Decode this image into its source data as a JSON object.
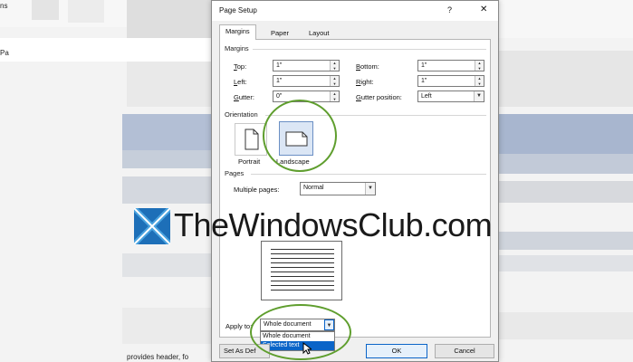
{
  "background": {
    "top_left_text": "ns",
    "side_label": "Pa",
    "bottom_text": "provides header, fo"
  },
  "dialog": {
    "title": "Page Setup",
    "help_glyph": "?",
    "close_glyph": "✕",
    "tabs": [
      {
        "label": "Margins",
        "active": true
      },
      {
        "label": "Paper",
        "active": false
      },
      {
        "label": "Layout",
        "active": false
      }
    ],
    "margins": {
      "section_label": "Margins",
      "top": {
        "label_u": "T",
        "label_rest": "op:",
        "value": "1\""
      },
      "bottom": {
        "label_u": "B",
        "label_rest": "ottom:",
        "value": "1\""
      },
      "left": {
        "label_u": "L",
        "label_rest": "eft:",
        "value": "1\""
      },
      "right": {
        "label_u": "R",
        "label_rest": "ight:",
        "value": "1\""
      },
      "gutter": {
        "label_u": "G",
        "label_rest": "utter:",
        "value": "0\""
      },
      "gutter_position": {
        "label_u": "G",
        "label_rest": "utter position:",
        "value": "Left"
      }
    },
    "orientation": {
      "section_label": "Orientation",
      "portrait_label": "Portrait",
      "landscape_label": "Landscape",
      "selected": "Landscape"
    },
    "pages": {
      "section_label": "Pages",
      "multiple_pages_label": "Multiple pages:",
      "multiple_pages_value": "Normal"
    },
    "apply_to": {
      "label": "Apply to:",
      "value": "Whole document",
      "options": [
        "Whole document",
        "Selected text"
      ],
      "highlighted_option": "Selected text"
    },
    "buttons": {
      "set_as_default": "Set As Def",
      "ok": "OK",
      "cancel": "Cancel"
    }
  },
  "watermark": {
    "text": "TheWindowsClub.com",
    "colors": {
      "logo_blue": "#1d6fb8",
      "logo_light": "#4aa3df"
    }
  },
  "colors": {
    "highlight_ring": "#5f9e2e",
    "selection_blue": "#0a64c8"
  }
}
